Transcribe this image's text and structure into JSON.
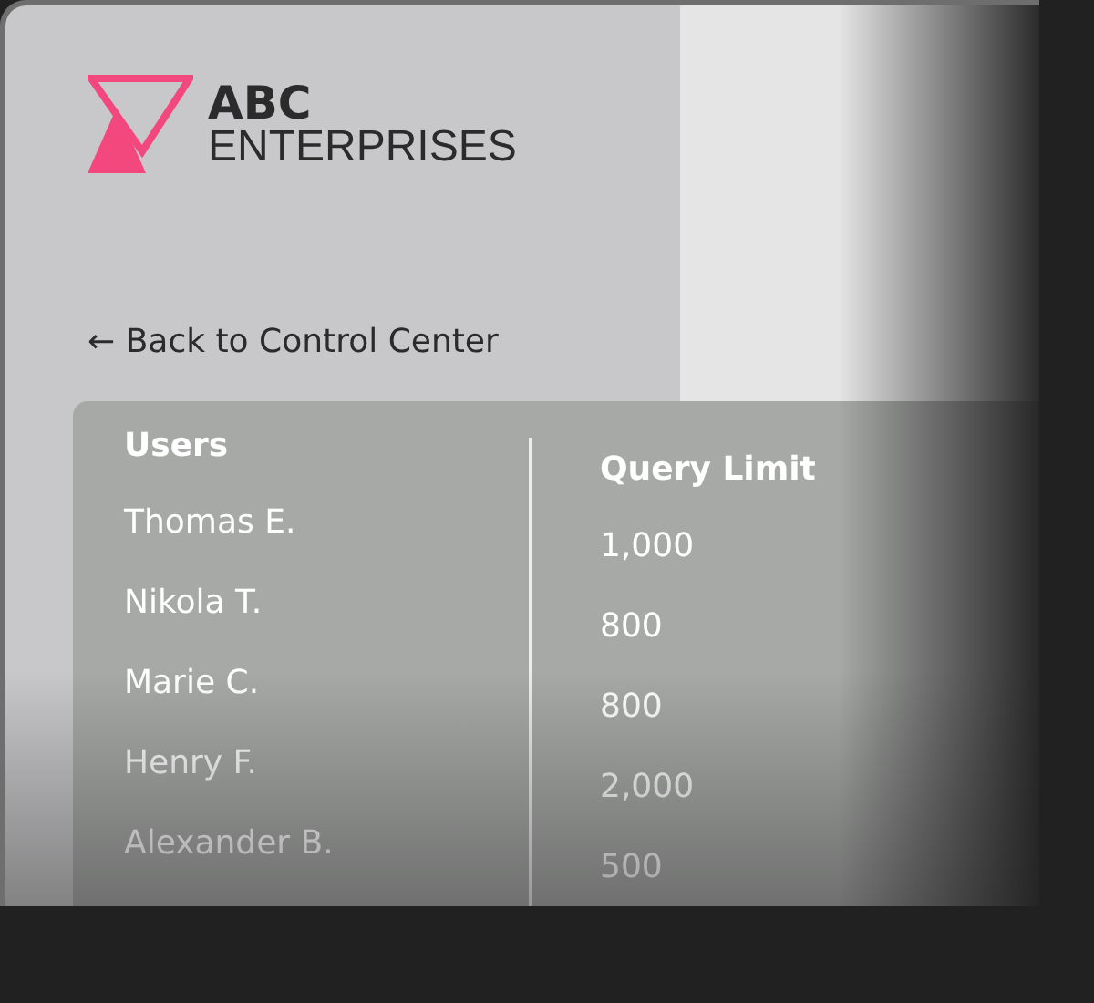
{
  "brand": {
    "name": "ABC",
    "subtitle": "ENTERPRISES"
  },
  "back_link": {
    "arrow": "←",
    "label": "Back to Control Center"
  },
  "table": {
    "columns": [
      "Users",
      "Query Limit"
    ],
    "rows": [
      [
        "Thomas E.",
        "1,000"
      ],
      [
        "Nikola T.",
        "800"
      ],
      [
        "Marie C.",
        "800"
      ],
      [
        "Henry F.",
        "2,000"
      ],
      [
        "Alexander B.",
        "500"
      ]
    ]
  }
}
